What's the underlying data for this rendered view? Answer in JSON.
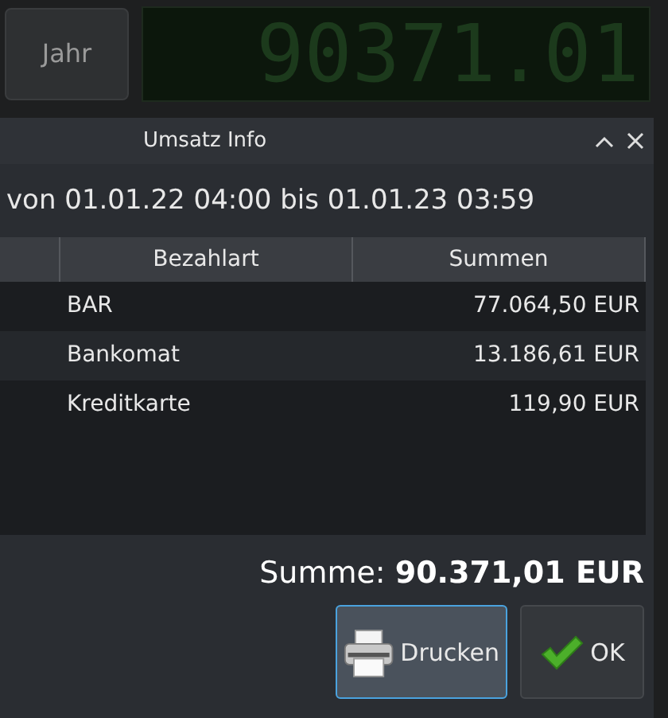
{
  "toolbar": {
    "button": "Jahr",
    "display": "90371.01"
  },
  "dialog": {
    "title": "Umsatz Info",
    "period": "von 01.01.22 04:00 bis 01.01.23 03:59",
    "table": {
      "columns": [
        "Bezahlart",
        "Summen"
      ],
      "rows": [
        {
          "method": "BAR",
          "sum": "77.064,50 EUR"
        },
        {
          "method": "Bankomat",
          "sum": "13.186,61 EUR"
        },
        {
          "method": "Kreditkarte",
          "sum": "119,90 EUR"
        }
      ]
    },
    "total": "Summe: **90.371,01 EUR**",
    "buttons": [
      {
        "kind": "print",
        "label": "Drucken",
        "focused": true
      },
      {
        "kind": "ok",
        "label": "OK",
        "focused": false
      }
    ]
  }
}
